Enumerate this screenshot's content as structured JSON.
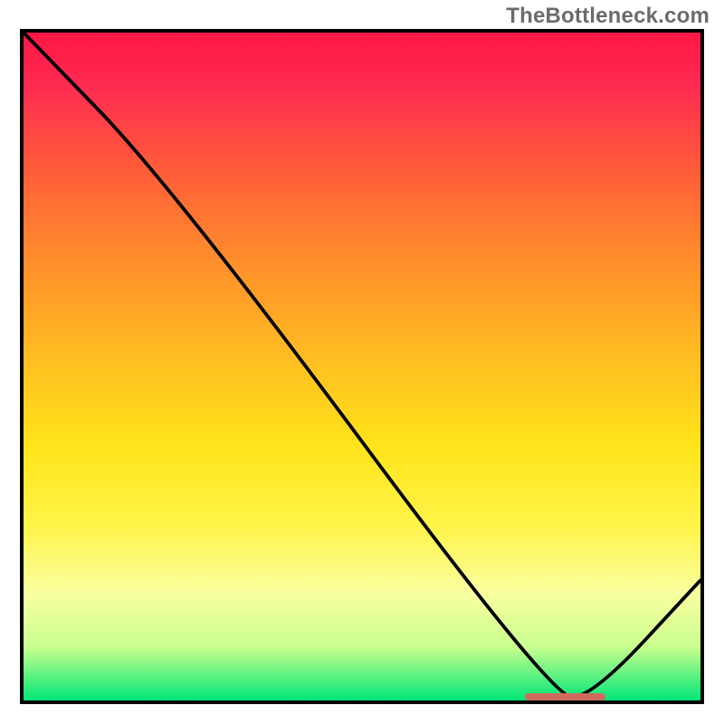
{
  "watermark": "TheBottleneck.com",
  "colors": {
    "line": "#000000",
    "marker": "#d16a5e",
    "border": "#000000",
    "grad_top": "#ff1744",
    "grad_bottom": "#00e676"
  },
  "chart_data": {
    "type": "line",
    "title": "",
    "xlabel": "",
    "ylabel": "",
    "xlim": [
      0,
      100
    ],
    "ylim": [
      0,
      100
    ],
    "x": [
      0,
      22,
      78,
      84,
      100
    ],
    "values": [
      100,
      77,
      0.5,
      0.5,
      18
    ],
    "marker": {
      "x_start": 74,
      "x_end": 86,
      "y": 0.5
    },
    "notes": "Axes are untick-labeled in the source image; x and y are normalized 0–100. The curve descends from top-left, changes slope around x≈22, reaches near-zero at x≈78–84 (optimum band shown by the marker), then rises to ≈18 at the right edge."
  }
}
